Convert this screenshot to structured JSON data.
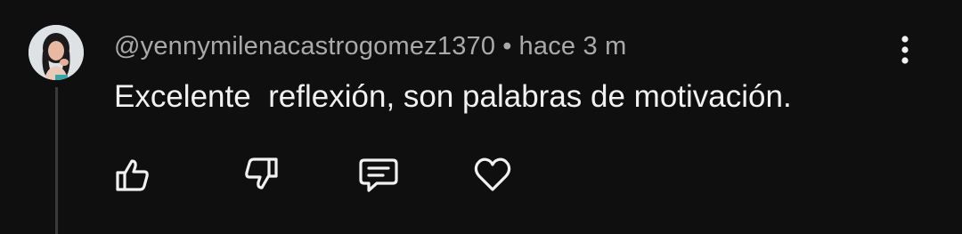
{
  "comment": {
    "author": "@yennymilenacastrogomez1370",
    "separator": "•",
    "timestamp": "hace 3 m",
    "text": "Excelente  reflexión, son palabras de motivación."
  },
  "actions": [
    {
      "icon": "thumbs-up-icon"
    },
    {
      "icon": "thumbs-down-icon"
    },
    {
      "icon": "reply-icon"
    },
    {
      "icon": "heart-icon"
    }
  ],
  "menu": {
    "icon": "more-vert-icon"
  },
  "colors": {
    "background": "#0f0f0f",
    "primary_text": "#f1f1f1",
    "secondary_text": "#aaaaaa",
    "thread_line": "#3a3a3a"
  }
}
